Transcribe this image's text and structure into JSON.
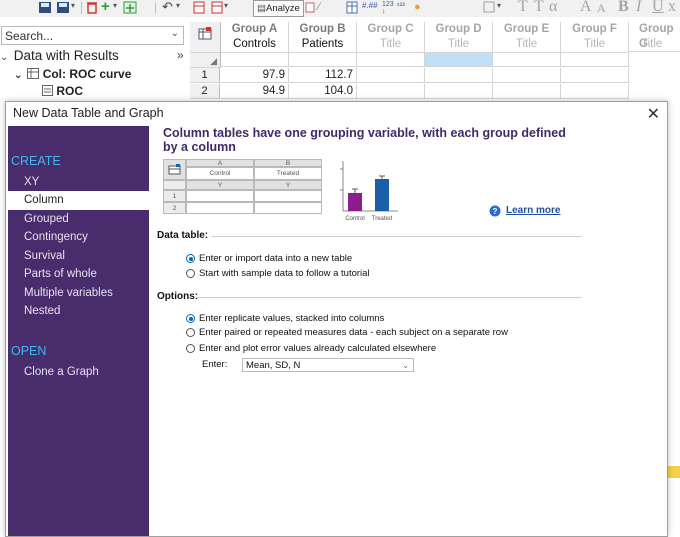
{
  "app": {
    "toolbar": {
      "analyze_label": "Analyze",
      "format_glyphs": [
        "T",
        "T",
        "α",
        "A",
        "A",
        "B",
        "I",
        "U",
        "x"
      ],
      "sort_glyph": "123"
    },
    "navigator": {
      "search_placeholder": "Search...",
      "items": [
        {
          "label": "Data with Results",
          "chevron": "⌄",
          "expand": "»"
        },
        {
          "label": "Col: ROC curve",
          "chevron": "⌄"
        },
        {
          "label": "ROC"
        }
      ]
    },
    "sheet": {
      "columns": [
        {
          "group": "Group A",
          "title": "Controls"
        },
        {
          "group": "Group B",
          "title": "Patients"
        },
        {
          "group": "Group C",
          "title": "Title"
        },
        {
          "group": "Group D",
          "title": "Title"
        },
        {
          "group": "Group E",
          "title": "Title"
        },
        {
          "group": "Group F",
          "title": "Title"
        },
        {
          "group": "Group G",
          "title": "Title"
        }
      ],
      "rows": [
        {
          "num": "1",
          "a": "97.9",
          "b": "112.7"
        },
        {
          "num": "2",
          "a": "94.9",
          "b": "104.0"
        }
      ]
    }
  },
  "dialog": {
    "title": "New Data Table and Graph",
    "sidebar": {
      "create_heading": "CREATE",
      "create_items": [
        "XY",
        "Column",
        "Grouped",
        "Contingency",
        "Survival",
        "Parts of whole",
        "Multiple variables",
        "Nested"
      ],
      "selected": "Column",
      "open_heading": "OPEN",
      "open_items": [
        "Clone a Graph"
      ]
    },
    "heading": "Column tables have one grouping variable, with each group defined by a column",
    "mini_table": {
      "cols": [
        "A",
        "B"
      ],
      "titles": [
        "Control",
        "Treated"
      ],
      "sub": [
        "Y",
        "Y"
      ],
      "rows": [
        "1",
        "2"
      ]
    },
    "mini_chart": {
      "categories": [
        "Control",
        "Treated"
      ],
      "colors": [
        "#8b1d8f",
        "#1a5ea8"
      ]
    },
    "learn_more": "Learn more",
    "data_table": {
      "label": "Data table:",
      "options": [
        "Enter or import data into a new table",
        "Start with sample data to follow a tutorial"
      ],
      "selected_index": 0
    },
    "options": {
      "label": "Options:",
      "choices": [
        "Enter replicate values, stacked into columns",
        "Enter paired or repeated measures data - each subject on a separate row",
        "Enter and plot error values already calculated elsewhere"
      ],
      "selected_index": 0,
      "enter_label": "Enter:",
      "enter_value": "Mean, SD, N"
    }
  }
}
